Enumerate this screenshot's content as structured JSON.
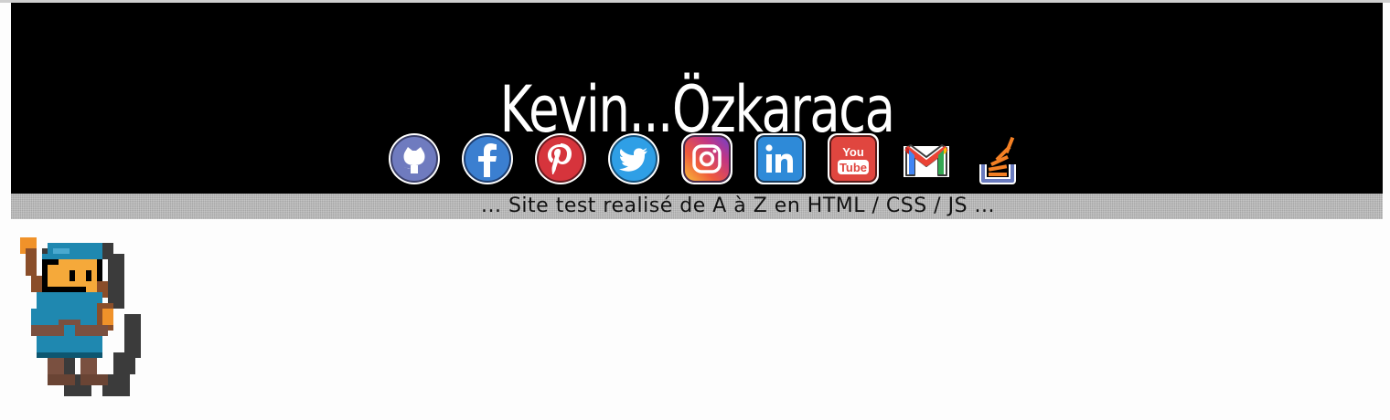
{
  "site": {
    "title": "Kevin...Özkaraca",
    "tagline": "... Site test realisé de A à Z en HTML / CSS / JS ..."
  },
  "social": [
    {
      "name": "github",
      "icon": "github-icon",
      "color": "#6f7bbf"
    },
    {
      "name": "facebook",
      "icon": "facebook-icon",
      "color": "#3b7fd0"
    },
    {
      "name": "pinterest",
      "icon": "pinterest-icon",
      "color": "#d6343c"
    },
    {
      "name": "twitter",
      "icon": "twitter-icon",
      "color": "#2f9fe6"
    },
    {
      "name": "instagram",
      "icon": "instagram-icon",
      "color": "#c13584"
    },
    {
      "name": "linkedin",
      "icon": "linkedin-icon",
      "color": "#2e8ad8"
    },
    {
      "name": "youtube",
      "icon": "youtube-icon",
      "color": "#e0463f"
    },
    {
      "name": "gmail",
      "icon": "gmail-icon",
      "color": "#ea4335"
    },
    {
      "name": "stackoverflow",
      "icon": "stackoverflow-icon",
      "color": "#f48024"
    }
  ],
  "colors": {
    "header_bg": "#000000",
    "title_fg": "#ffffff",
    "tagline_bar": "#b9b9b9",
    "page_bg": "#fdfdfd"
  },
  "sprite": {
    "icon": "pixel-adventurer-icon"
  }
}
